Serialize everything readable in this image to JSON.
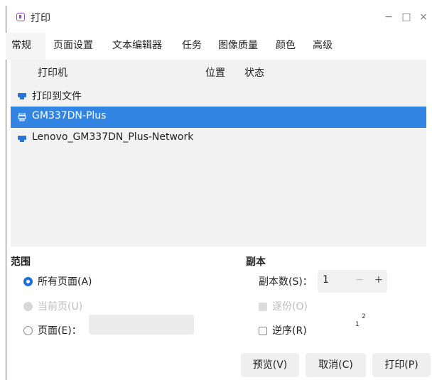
{
  "window": {
    "title": "打印",
    "min": "−",
    "max": "□",
    "close": "×"
  },
  "tabs": [
    "常规",
    "页面设置",
    "文本编辑器",
    "任务",
    "图像质量",
    "颜色",
    "高级"
  ],
  "printer_list": {
    "headers": {
      "printer": "打印机",
      "location": "位置",
      "status": "状态"
    },
    "rows": [
      {
        "name": "打印到文件",
        "selected": false
      },
      {
        "name": "GM337DN-Plus",
        "selected": true
      },
      {
        "name": "Lenovo_GM337DN_Plus-Network",
        "selected": false
      }
    ]
  },
  "range": {
    "title": "范围",
    "all_pages": "所有页面(A)",
    "current_page": "当前页(U)",
    "pages": "页面(E)：",
    "pages_value": ""
  },
  "copies": {
    "title": "副本",
    "count_label": "副本数(S)：",
    "count_value": "1",
    "minus": "−",
    "plus": "+",
    "collate": "逐份(O)",
    "reverse": "逆序(R)",
    "collate_icon_1": "1",
    "collate_icon_2": "2"
  },
  "buttons": {
    "preview": "预览(V)",
    "cancel": "取消(C)",
    "print": "打印(P)"
  },
  "colors": {
    "selection": "#3385e3",
    "accent": "#1e6fdc"
  }
}
